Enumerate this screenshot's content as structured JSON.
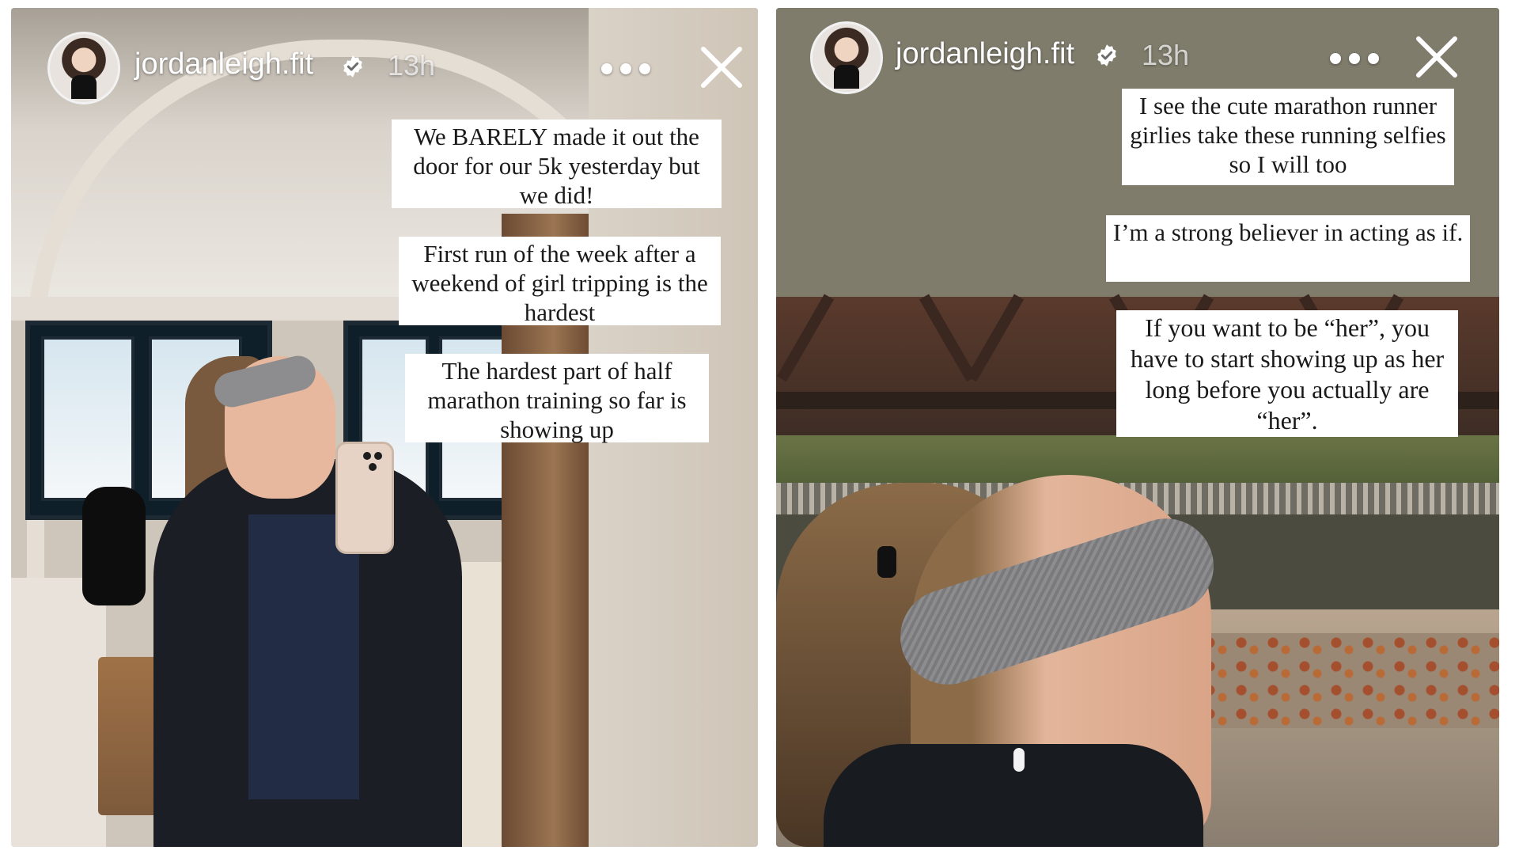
{
  "stories": [
    {
      "username": "jordanleigh.fit",
      "time": "13h",
      "captions": [
        "We BARELY made it out the door for our 5k yesterday but we did!",
        "First run of the week after a weekend of girl tripping is the hardest",
        "The hardest part of half marathon training so far is showing up"
      ]
    },
    {
      "username": "jordanleigh.fit",
      "time": "13h",
      "captions": [
        "I see the cute marathon runner girlies take these running selfies so I will too",
        "I’m a strong believer in acting as if.",
        "If you want to be “her”, you have to start showing up as her long before you actually are “her”."
      ]
    }
  ],
  "icons": {
    "verified": "verified-badge-icon",
    "more": "more-options-icon",
    "close": "close-icon"
  },
  "colors": {
    "caption_background": "#ffffff",
    "caption_text": "#1a1a1a",
    "header_text": "#ffffff"
  }
}
